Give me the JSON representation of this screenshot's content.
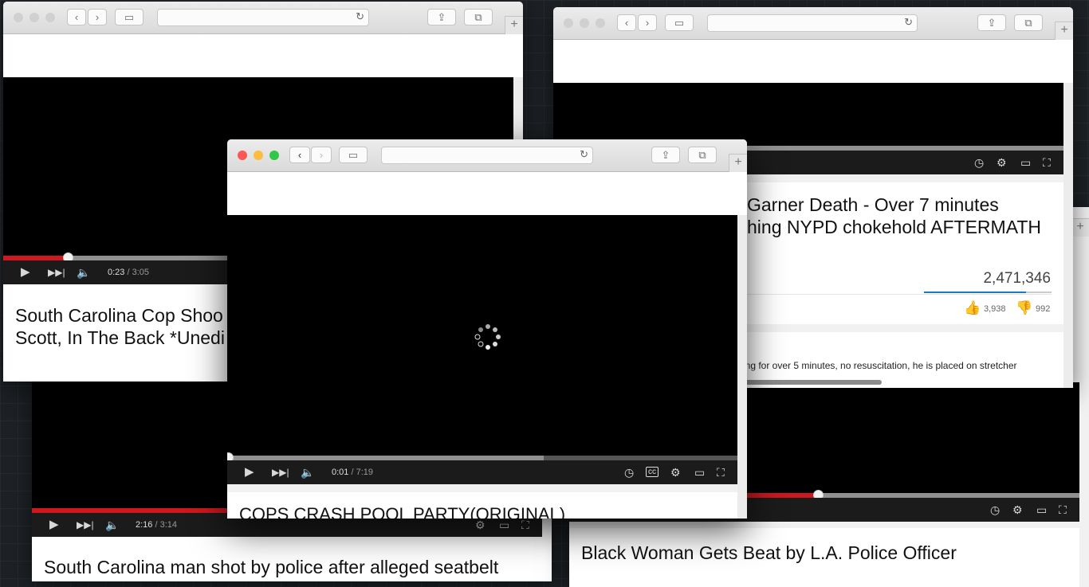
{
  "windows": {
    "top_left": {
      "progress": {
        "elapsed": "0:23",
        "duration": "/ 3:05",
        "fraction": 0.127
      },
      "title_line1": "South Carolina Cop Shoo",
      "title_line2": "Scott, In The Back *Unedi"
    },
    "top_right": {
      "title_line1": "Garner Death - Over 7 minutes",
      "title_line2": "hing NYPD chokehold AFTERMATH",
      "views": "2,471,346",
      "likes": "3,938",
      "dislikes": "992",
      "description": "ing for over 5 minutes, no resuscitation, he is placed on stretcher"
    },
    "bottom_left": {
      "progress": {
        "elapsed": "2:16",
        "duration": "/ 3:14"
      },
      "title": "South Carolina man shot by police after alleged seatbelt"
    },
    "bottom_right": {
      "title": "Black Woman Gets Beat by L.A. Police Officer"
    },
    "front": {
      "progress": {
        "elapsed": "0:01",
        "duration": "/ 7:19",
        "fraction": 0.002
      },
      "title": "COPS CRASH POOL PARTY(ORIGINAL)"
    }
  },
  "colors": {
    "progress_red": "#cc181e",
    "traffic_close": "#fc5753",
    "traffic_min": "#fdbc40",
    "traffic_max": "#33c748"
  }
}
